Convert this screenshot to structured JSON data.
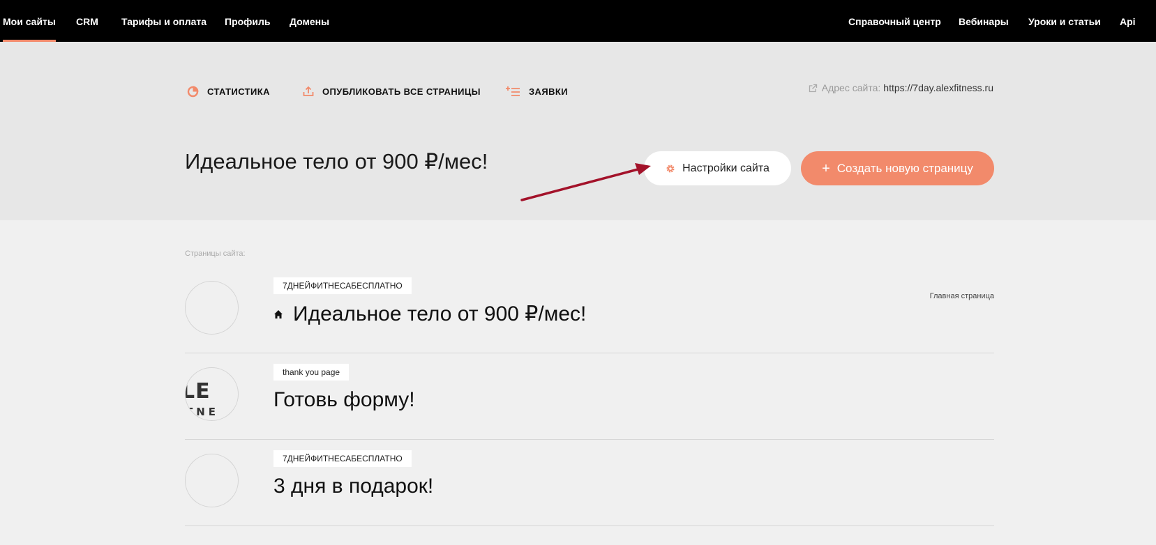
{
  "topnav": {
    "left": [
      "Мои сайты",
      "CRM",
      "Тарифы и оплата",
      "Профиль",
      "Домены"
    ],
    "right": [
      "Справочный центр",
      "Вебинары",
      "Уроки и статьи",
      "Api"
    ]
  },
  "actions": {
    "statistics": "СТАТИСТИКА",
    "publish_all": "ОПУБЛИКОВАТЬ ВСЕ СТРАНИЦЫ",
    "requests": "ЗАЯВКИ"
  },
  "site_address": {
    "label": "Адрес сайта:",
    "url": "https://7day.alexfitness.ru"
  },
  "site_title": "Идеальное тело от 900 ₽/мес!",
  "buttons": {
    "settings": "Настройки сайта",
    "create": "Создать новую страницу"
  },
  "pages_label": "Страницы сайта:",
  "pages": [
    {
      "tag": "7ДНЕЙФИТНЕСАБЕСПЛАТНО",
      "title": "Идеальное тело от 900 ₽/мес!",
      "badge": "Главная страница"
    },
    {
      "tag": "thank you page",
      "title": "Готовь форму!",
      "thumb_line1": "LE",
      "thumb_line2": "TNE"
    },
    {
      "tag": "7ДНЕЙФИТНЕСАБЕСПЛАТНО",
      "title": "3 дня в подарок!"
    }
  ],
  "colors": {
    "accent": "#f28a6b",
    "nav_bg": "#000000",
    "header_bg": "#e7e7e7",
    "body_bg": "#f0f0f0",
    "annotation_arrow": "#a3122a"
  }
}
